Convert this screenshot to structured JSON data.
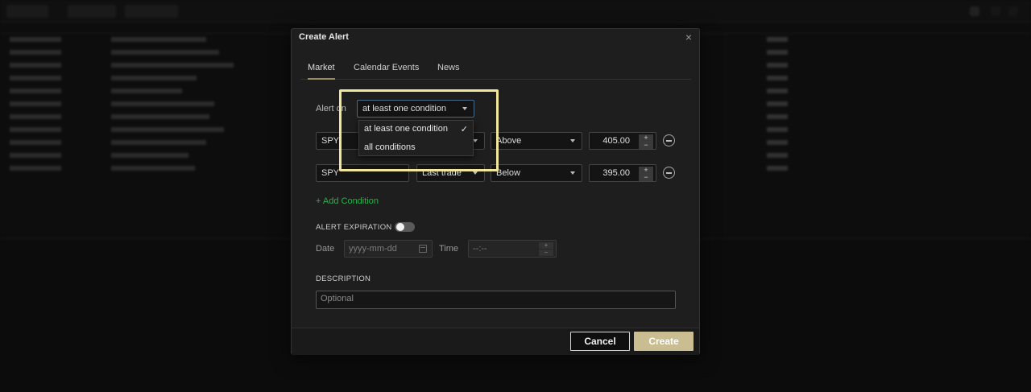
{
  "modal": {
    "title": "Create Alert",
    "tabs": [
      "Market",
      "Calendar Events",
      "News"
    ],
    "alert_on_label": "Alert on",
    "alert_on_value": "at least one condition",
    "alert_on_options": [
      "at least one condition",
      "all conditions"
    ],
    "conditions": [
      {
        "symbol": "SPY",
        "field": "",
        "comparator": "Above",
        "value": "405.00"
      },
      {
        "symbol": "SPY",
        "field": "Last trade",
        "comparator": "Below",
        "value": "395.00"
      }
    ],
    "add_condition": "+ Add Condition",
    "alert_expiration_label": "ALERT EXPIRATION",
    "date_label": "Date",
    "date_placeholder": "yyyy-mm-dd",
    "time_label": "Time",
    "time_placeholder": "--:--",
    "description_label": "DESCRIPTION",
    "description_placeholder": "Optional",
    "cancel_label": "Cancel",
    "create_label": "Create"
  },
  "colors": {
    "accent": "#cbbd92",
    "add_condition": "#27b14a",
    "highlight": "#f1e79b"
  }
}
